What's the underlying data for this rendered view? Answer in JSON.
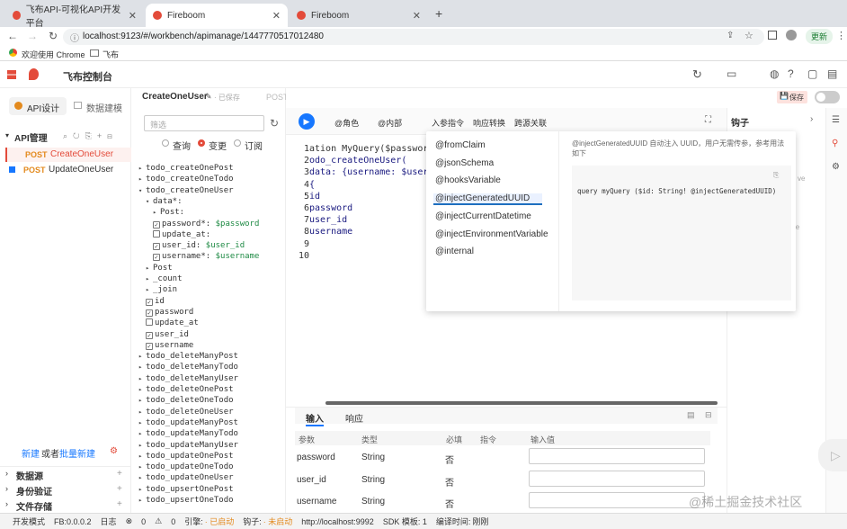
{
  "browser": {
    "tabs": [
      {
        "label": "飞布API-可视化API开发平台"
      },
      {
        "label": "Fireboom"
      },
      {
        "label": "Fireboom"
      }
    ],
    "new_tab": "+",
    "url": "localhost:9123/#/workbench/apimanage/1447770517012480",
    "update_label": "更新",
    "bookmarks": [
      "欢迎使用 Chrome",
      "飞布"
    ]
  },
  "app": {
    "title": "飞布控制台",
    "api_name": "CreateOneUser",
    "saved_state": "· 已保存",
    "method": "POST",
    "save_label": "保存"
  },
  "left_nav": {
    "tab_api": "API设计",
    "tab_data": "数据建模",
    "api_manage": "API管理",
    "apis": [
      {
        "method": "POST",
        "name": "CreateOneUser"
      },
      {
        "method": "POST",
        "name": "UpdateOneUser"
      }
    ],
    "new_text": "新建",
    "or_text": "或者",
    "batch_new": "批量新建",
    "sections": [
      "数据源",
      "身份验证",
      "文件存储"
    ]
  },
  "tree": {
    "filter_placeholder": "筛选",
    "modes": [
      "查询",
      "变更",
      "订阅"
    ],
    "rows": [
      {
        "text": "todo_createOnePost",
        "indent": 0,
        "caret": "▸"
      },
      {
        "text": "todo_createOneTodo",
        "indent": 0,
        "caret": "▸"
      },
      {
        "text": "todo_createOneUser",
        "indent": 0,
        "caret": "▾"
      },
      {
        "text": "data*:",
        "indent": 1,
        "caret": "▾"
      },
      {
        "text": "Post:",
        "indent": 2,
        "caret": "▸"
      },
      {
        "text": "password*: $password",
        "indent": 2,
        "cb": "on"
      },
      {
        "text": "update_at:",
        "indent": 2,
        "cb": "off"
      },
      {
        "text": "user_id: $user_id",
        "indent": 2,
        "cb": "on"
      },
      {
        "text": "username*: $username",
        "indent": 2,
        "cb": "on"
      },
      {
        "text": "Post",
        "indent": 1,
        "caret": "▸"
      },
      {
        "text": "_count",
        "indent": 1,
        "caret": "▸"
      },
      {
        "text": "_join",
        "indent": 1,
        "caret": "▸"
      },
      {
        "text": "id",
        "indent": 1,
        "cb": "on"
      },
      {
        "text": "password",
        "indent": 1,
        "cb": "on"
      },
      {
        "text": "update_at",
        "indent": 1,
        "cb": "off"
      },
      {
        "text": "user_id",
        "indent": 1,
        "cb": "on"
      },
      {
        "text": "username",
        "indent": 1,
        "cb": "on"
      },
      {
        "text": "todo_deleteManyPost",
        "indent": 0,
        "caret": "▸"
      },
      {
        "text": "todo_deleteManyTodo",
        "indent": 0,
        "caret": "▸"
      },
      {
        "text": "todo_deleteManyUser",
        "indent": 0,
        "caret": "▸"
      },
      {
        "text": "todo_deleteOnePost",
        "indent": 0,
        "caret": "▸"
      },
      {
        "text": "todo_deleteOneTodo",
        "indent": 0,
        "caret": "▸"
      },
      {
        "text": "todo_deleteOneUser",
        "indent": 0,
        "caret": "▸"
      },
      {
        "text": "todo_updateManyPost",
        "indent": 0,
        "caret": "▸"
      },
      {
        "text": "todo_updateManyTodo",
        "indent": 0,
        "caret": "▸"
      },
      {
        "text": "todo_updateManyUser",
        "indent": 0,
        "caret": "▸"
      },
      {
        "text": "todo_updateOnePost",
        "indent": 0,
        "caret": "▸"
      },
      {
        "text": "todo_updateOneTodo",
        "indent": 0,
        "caret": "▸"
      },
      {
        "text": "todo_updateOneUser",
        "indent": 0,
        "caret": "▸"
      },
      {
        "text": "todo_upsertOnePost",
        "indent": 0,
        "caret": "▸"
      },
      {
        "text": "todo_upsertOneTodo",
        "indent": 0,
        "caret": "▸"
      }
    ]
  },
  "toolbar": {
    "role": "@角色",
    "internal": "@内部",
    "directive": "入参指令",
    "transform": "响应转换",
    "cross": "跨源关联"
  },
  "editor": {
    "lines": [
      {
        "n": "1",
        "text": "ation MyQuery($password: S"
      },
      {
        "n": "2",
        "text": "odo_createOneUser("
      },
      {
        "n": "3",
        "text": " data: {username: $usernam"
      },
      {
        "n": "4",
        "text": " {"
      },
      {
        "n": "5",
        "text": " id"
      },
      {
        "n": "6",
        "text": " password"
      },
      {
        "n": "7",
        "text": " user_id"
      },
      {
        "n": "8",
        "text": " username"
      },
      {
        "n": "9",
        "text": ""
      },
      {
        "n": "10",
        "text": ""
      }
    ]
  },
  "popup": {
    "items": [
      "@fromClaim",
      "@jsonSchema",
      "@hooksVariable",
      "@injectGeneratedUUID",
      "@injectCurrentDatetime",
      "@injectEnvironmentVariable",
      "@internal"
    ],
    "selected": "@injectGeneratedUUID",
    "desc": "@injectGeneratedUUID 自动注入 UUID，用户无需传参，参考用法如下",
    "code": "query myQuery ($id: String! @injectGeneratedUUID)"
  },
  "params": {
    "tabs": [
      "输入",
      "响应"
    ],
    "headers": [
      "参数",
      "类型",
      "必填",
      "指令",
      "输入值"
    ],
    "rows": [
      {
        "name": "password",
        "type": "String",
        "required": "否"
      },
      {
        "name": "user_id",
        "type": "String",
        "required": "否"
      },
      {
        "name": "username",
        "type": "String",
        "required": "否"
      }
    ]
  },
  "hook": {
    "title": "钩子",
    "frag1": "ve",
    "frag2": "lve"
  },
  "status": {
    "mode": "开发模式",
    "version": "FB:0.0.0.2",
    "log": "日志",
    "err": "0",
    "warn": "0",
    "engine_label": "引擎:",
    "engine": "· 已启动",
    "hook_label": "钩子:",
    "hook": "· 未启动",
    "url": "http://localhost:9992",
    "sdk": "SDK 模板: 1",
    "compile_label": "编译时间:",
    "compile": "刚刚"
  },
  "watermark": "@稀土掘金技术社区",
  "colors": {
    "accent": "#1677ff",
    "post": "#e38a1e",
    "brand": "#e34b3a"
  }
}
